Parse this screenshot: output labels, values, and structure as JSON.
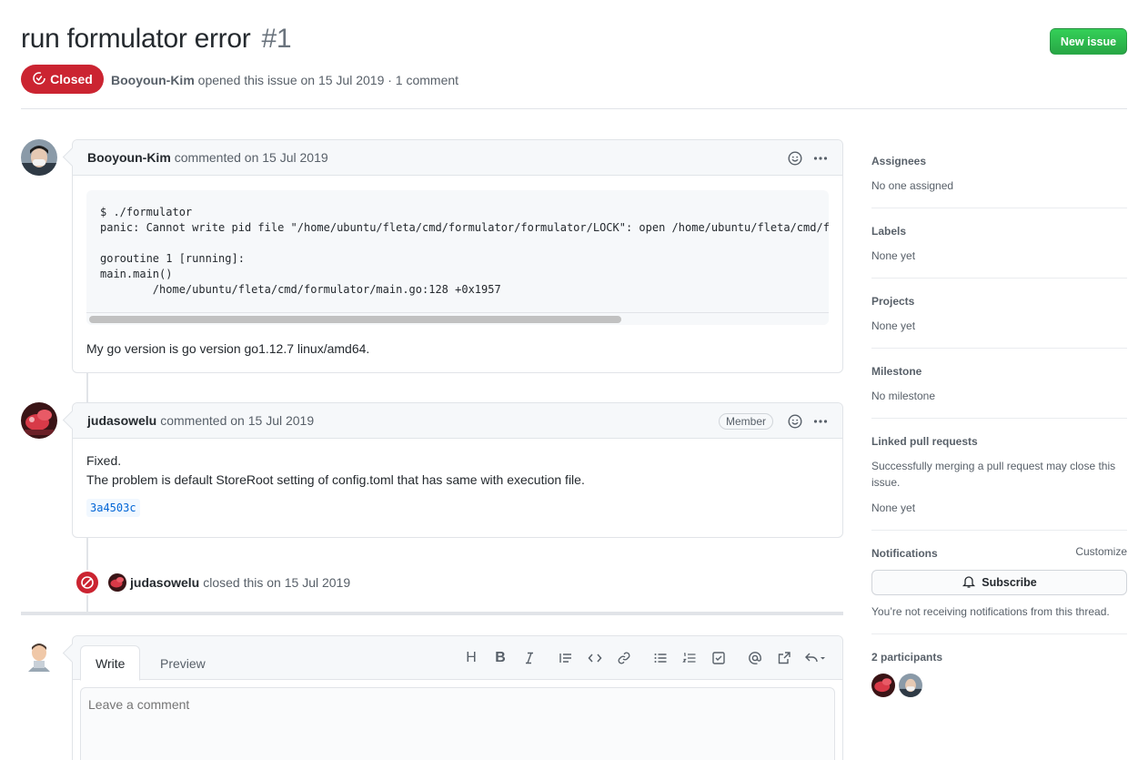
{
  "header": {
    "title": "run formulator error",
    "number": "#1",
    "new_issue_label": "New issue",
    "state": "Closed",
    "author": "Booyoun-Kim",
    "meta_text": "opened this issue on 15 Jul 2019 · 1 comment"
  },
  "comments": [
    {
      "author": "Booyoun-Kim",
      "meta": "commented on 15 Jul 2019",
      "code": "$ ./formulator\npanic: Cannot write pid file \"/home/ubuntu/fleta/cmd/formulator/formulator/LOCK\": open /home/ubuntu/fleta/cmd/formulator/formulator/LOCK\n\ngoroutine 1 [running]:\nmain.main()\n        /home/ubuntu/fleta/cmd/formulator/main.go:128 +0x1957",
      "text": "My go version is go version go1.12.7 linux/amd64."
    },
    {
      "author": "judasowelu",
      "meta": "commented on 15 Jul 2019",
      "badge": "Member",
      "line1": "Fixed.",
      "line2": "The problem is default StoreRoot setting of config.toml that has same with execution file.",
      "commit": "3a4503c"
    }
  ],
  "event": {
    "author": "judasowelu",
    "text": "closed this on 15 Jul 2019"
  },
  "editor": {
    "tab_write": "Write",
    "tab_preview": "Preview",
    "placeholder": "Leave a comment",
    "tools": [
      "heading-icon",
      "bold-icon",
      "italic-icon",
      "quote-icon",
      "code-icon",
      "link-icon",
      "bullet-list-icon",
      "numbered-list-icon",
      "task-list-icon",
      "mention-icon",
      "cross-reference-icon",
      "reply-icon"
    ]
  },
  "sidebar": {
    "assignees_heading": "Assignees",
    "assignees_value": "No one assigned",
    "labels_heading": "Labels",
    "labels_value": "None yet",
    "projects_heading": "Projects",
    "projects_value": "None yet",
    "milestone_heading": "Milestone",
    "milestone_value": "No milestone",
    "linked_heading": "Linked pull requests",
    "linked_desc": "Successfully merging a pull request may close this issue.",
    "linked_value": "None yet",
    "notifications_heading": "Notifications",
    "customize_label": "Customize",
    "subscribe_label": "Subscribe",
    "notifications_text": "You’re not receiving notifications from this thread.",
    "participants_heading": "2 participants"
  },
  "colors": {
    "closed_red": "#cb2431",
    "new_issue_green": "#2ea44f",
    "link_blue": "#0366d6"
  }
}
